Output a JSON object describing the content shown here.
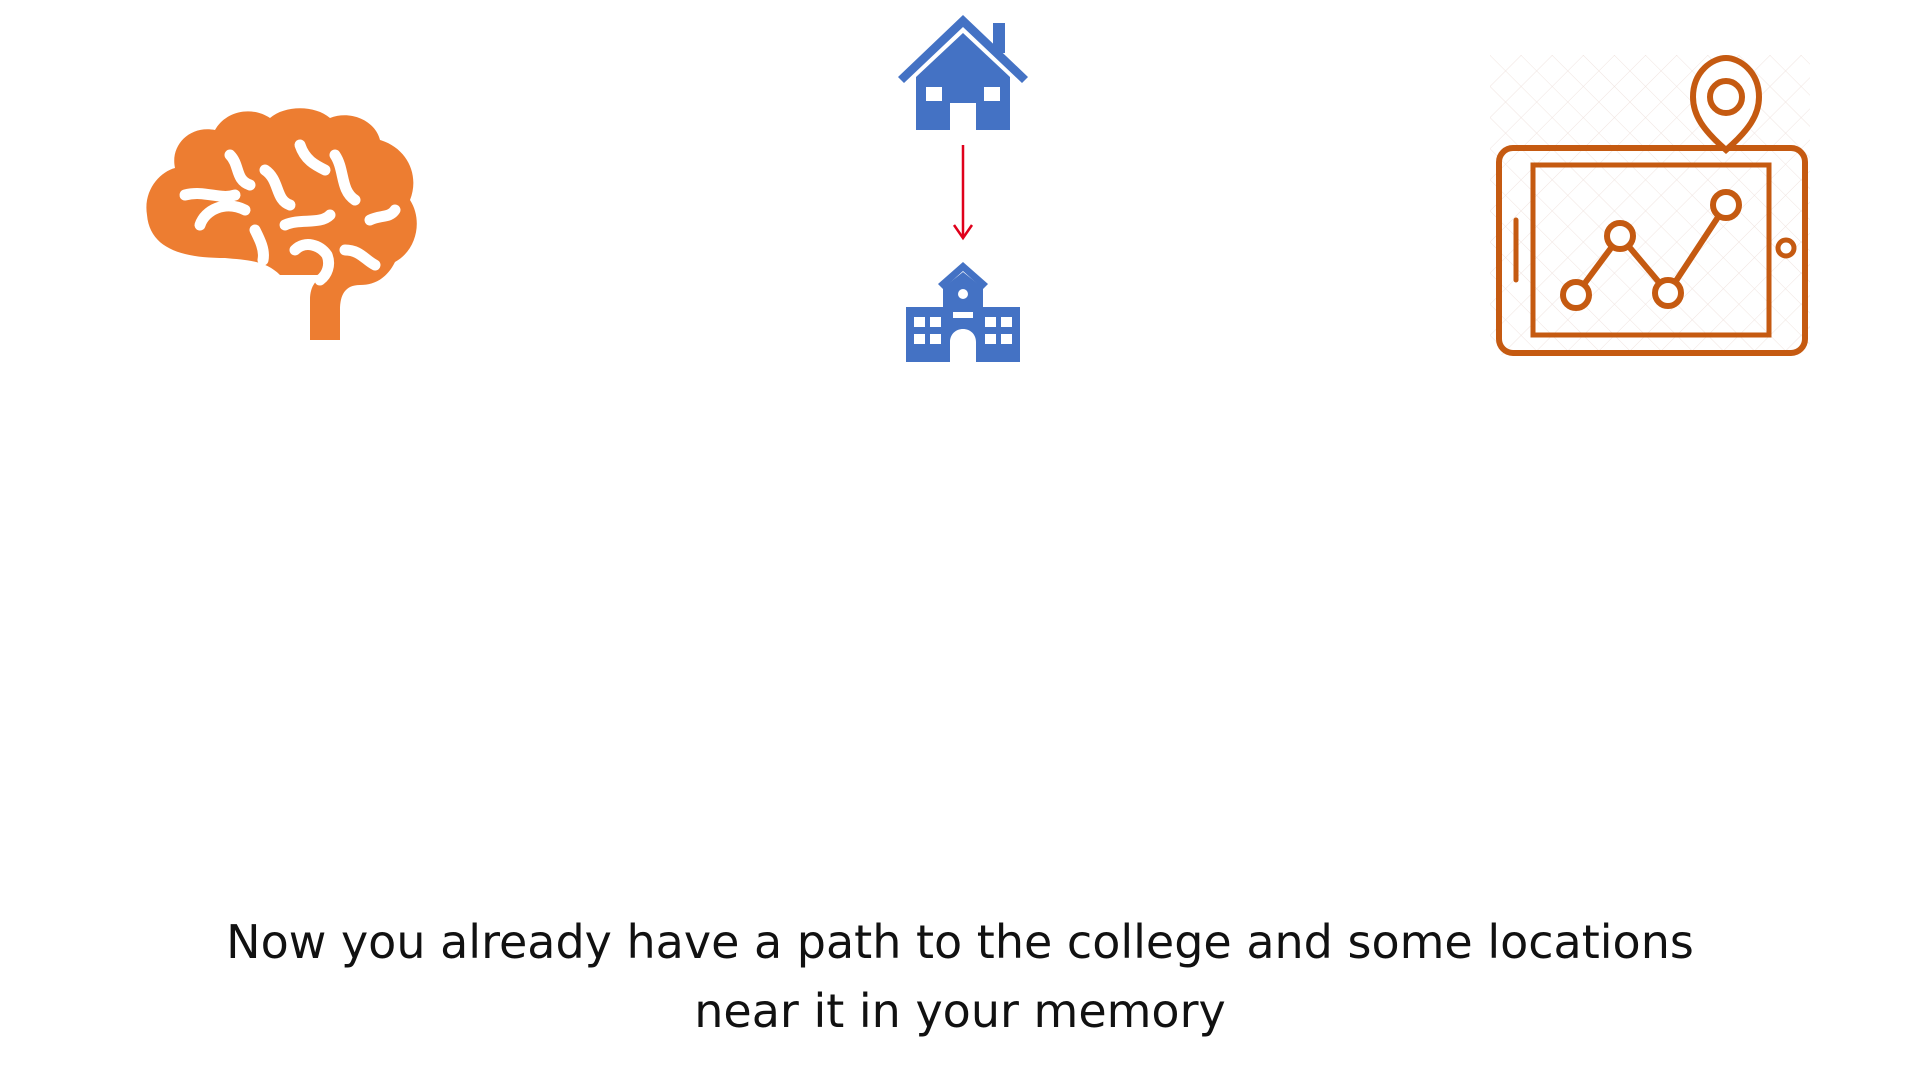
{
  "slide": {
    "icons": {
      "brain": "brain-icon",
      "house": "house-icon",
      "arrow": "arrow-down-icon",
      "school": "school-building-icon",
      "map": "map-tablet-icon"
    },
    "colors": {
      "orange": "#ED7D31",
      "blue": "#4472C4",
      "red": "#E0001B",
      "dark_orange": "#C55A11",
      "text": "#111111"
    },
    "caption": {
      "line1": "Now you already have a path to the college and some locations",
      "line2": "near it in your memory"
    }
  }
}
